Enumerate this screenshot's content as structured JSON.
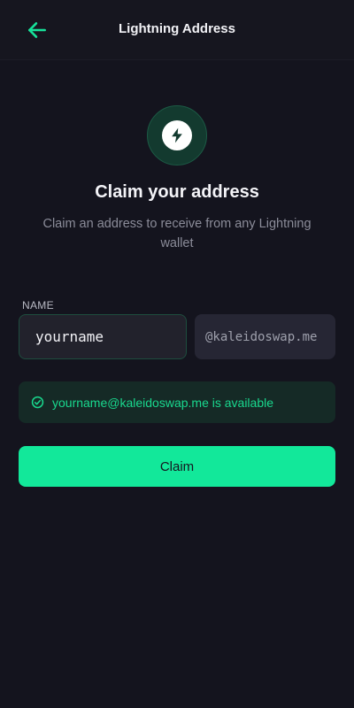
{
  "header": {
    "title": "Lightning Address",
    "back_icon": "arrow-left-icon"
  },
  "hero": {
    "icon": "lightning-bolt-icon",
    "title": "Claim your address",
    "subtitle": "Claim an address to receive from any Lightning wallet"
  },
  "form": {
    "name_label": "NAME",
    "name_value": "yourname",
    "domain_suffix": "@kaleidoswap.me"
  },
  "availability": {
    "icon": "check-circle-icon",
    "text": "yourname@kaleidoswap.me is available"
  },
  "actions": {
    "claim_label": "Claim"
  },
  "colors": {
    "background": "#14141e",
    "accent": "#12e89a",
    "success_text": "#19d88e",
    "success_bg": "#152a26"
  }
}
